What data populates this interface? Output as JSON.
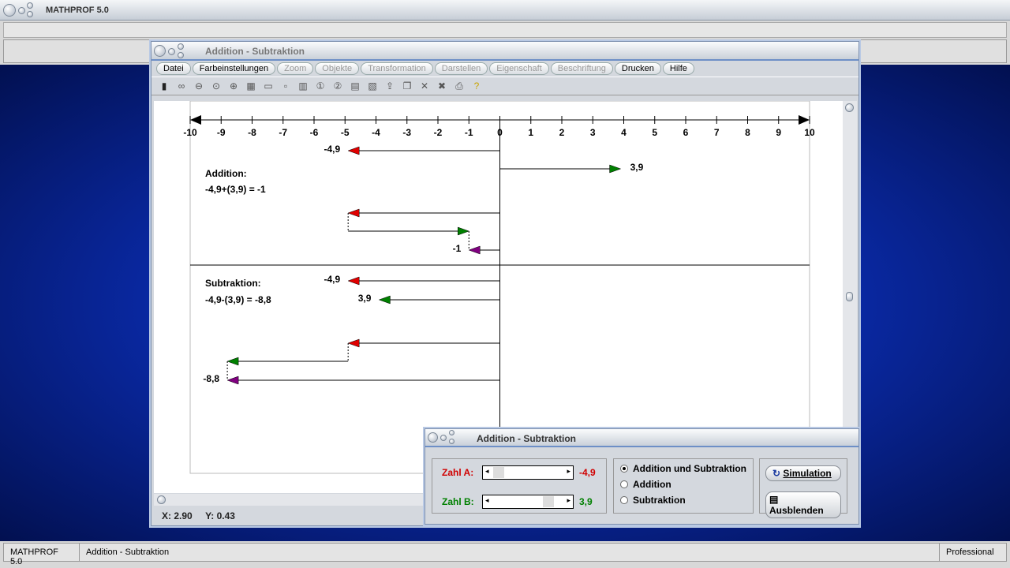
{
  "app": {
    "title": "MATHPROF 5.0"
  },
  "window": {
    "title": "Addition - Subtraktion",
    "menu": [
      {
        "label": "Datei",
        "enabled": true
      },
      {
        "label": "Farbeinstellungen",
        "enabled": true
      },
      {
        "label": "Zoom",
        "enabled": false
      },
      {
        "label": "Objekte",
        "enabled": false
      },
      {
        "label": "Transformation",
        "enabled": false
      },
      {
        "label": "Darstellen",
        "enabled": false
      },
      {
        "label": "Eigenschaft",
        "enabled": false
      },
      {
        "label": "Beschriftung",
        "enabled": false
      },
      {
        "label": "Drucken",
        "enabled": true
      },
      {
        "label": "Hilfe",
        "enabled": true
      }
    ],
    "toolbar_icons": [
      "window-icon",
      "glasses-icon",
      "zoom-out-icon",
      "zoom-icon",
      "zoom-in-icon",
      "properties-icon",
      "frame-icon",
      "small-box-icon",
      "grid-box-icon",
      "circle-1-icon",
      "circle-2-icon",
      "table-icon",
      "chart-edit-icon",
      "export-icon",
      "copy-icon",
      "cross-icon",
      "cross-double-icon",
      "print-icon",
      "help-icon"
    ],
    "coords": {
      "x": "X: 2.90",
      "y": "Y: 0.43"
    }
  },
  "number_line": {
    "min": -10,
    "max": 10,
    "ticks": [
      "-10",
      "-9",
      "-8",
      "-7",
      "-6",
      "-5",
      "-4",
      "-3",
      "-2",
      "-1",
      "0",
      "1",
      "2",
      "3",
      "4",
      "5",
      "6",
      "7",
      "8",
      "9",
      "10"
    ]
  },
  "addition": {
    "title": "Addition:",
    "equation": "-4,9+(3,9) = -1"
  },
  "subtraction": {
    "title": "Subtraktion:",
    "equation": "-4,9-(3,9) = -8,8"
  },
  "arrows": [
    {
      "row": "a",
      "from": 0,
      "to": -4.9,
      "color": "#e00000",
      "label": "-4,9"
    },
    {
      "row": "b",
      "from": 0,
      "to": 3.9,
      "color": "#008000",
      "label": "3,9"
    },
    {
      "row": "add1",
      "from": 0,
      "to": -4.9,
      "color": "#e00000",
      "label": ""
    },
    {
      "row": "add2",
      "from": -4.9,
      "to": -1,
      "color": "#008000",
      "label": ""
    },
    {
      "row": "add3",
      "from": 0,
      "to": -1,
      "color": "#800080",
      "label": "-1"
    },
    {
      "row": "sa",
      "from": 0,
      "to": -4.9,
      "color": "#e00000",
      "label": "-4,9"
    },
    {
      "row": "sb",
      "from": 0,
      "to": -3.9,
      "color": "#008000",
      "label": "3,9"
    },
    {
      "row": "sub1",
      "from": 0,
      "to": -4.9,
      "color": "#e00000",
      "label": ""
    },
    {
      "row": "sub2",
      "from": -4.9,
      "to": -8.8,
      "color": "#008000",
      "label": ""
    },
    {
      "row": "sub3",
      "from": 0,
      "to": -8.8,
      "color": "#800080",
      "label": "-8,8"
    }
  ],
  "dialog": {
    "title": "Addition - Subtraktion",
    "zahl_a": {
      "label": "Zahl A:",
      "value": "-4,9",
      "color": "#d00000"
    },
    "zahl_b": {
      "label": "Zahl B:",
      "value": "3,9",
      "color": "#008000"
    },
    "options": [
      {
        "label": "Addition und Subtraktion",
        "selected": true
      },
      {
        "label": "Addition",
        "selected": false
      },
      {
        "label": "Subtraktion",
        "selected": false
      }
    ],
    "simulation": "Simulation",
    "ausblenden": "Ausblenden"
  },
  "statusbar": {
    "app": "MATHPROF 5.0",
    "module": "Addition - Subtraktion",
    "edition": "Professional"
  }
}
